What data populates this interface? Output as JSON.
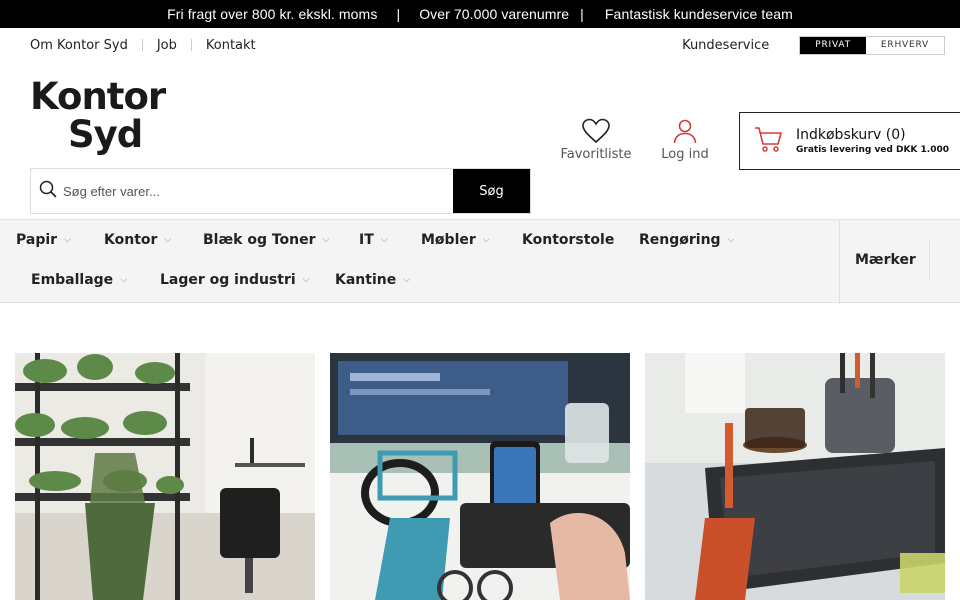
{
  "announcement": {
    "items": [
      "Fri fragt over 800 kr. ekskl. moms",
      "Over 70.000 varenumre",
      "Fantastisk kundeservice team"
    ],
    "separator": "|"
  },
  "utility_links": [
    "Om Kontor Syd",
    "Job",
    "Kontakt"
  ],
  "customer_service": "Kundeservice",
  "segment": {
    "active": "PRIVAT",
    "inactive": "ERHVERV"
  },
  "logo": {
    "line1": "Kontor",
    "line2": "Syd"
  },
  "search": {
    "placeholder": "Søg efter varer...",
    "value": "",
    "button_label": "Søg"
  },
  "favorites_label": "Favoritliste",
  "login_label": "Log ind",
  "cart": {
    "title": "Indkøbskurv (0)",
    "subtitle": "Gratis levering ved DKK 1.000"
  },
  "nav": {
    "items": [
      {
        "label": "Papir",
        "has_dropdown": true
      },
      {
        "label": "Kontor",
        "has_dropdown": true
      },
      {
        "label": "Blæk og Toner",
        "has_dropdown": true
      },
      {
        "label": "IT",
        "has_dropdown": true
      },
      {
        "label": "Møbler",
        "has_dropdown": true
      },
      {
        "label": "Kontorstole",
        "has_dropdown": false
      },
      {
        "label": "Rengøring",
        "has_dropdown": true
      },
      {
        "label": "Emballage",
        "has_dropdown": true
      },
      {
        "label": "Lager og industri",
        "has_dropdown": true
      },
      {
        "label": "Kantine",
        "has_dropdown": true
      }
    ],
    "brands": "Mærker"
  },
  "tiles": [
    {
      "subject": "office furniture",
      "accent": "#4f6b3d"
    },
    {
      "subject": "IT equipment",
      "accent": "#3f9bb1"
    },
    {
      "subject": "office supplies",
      "accent": "#c9502a"
    }
  ],
  "colors": {
    "topbar": "#000000",
    "button": "#000000"
  }
}
